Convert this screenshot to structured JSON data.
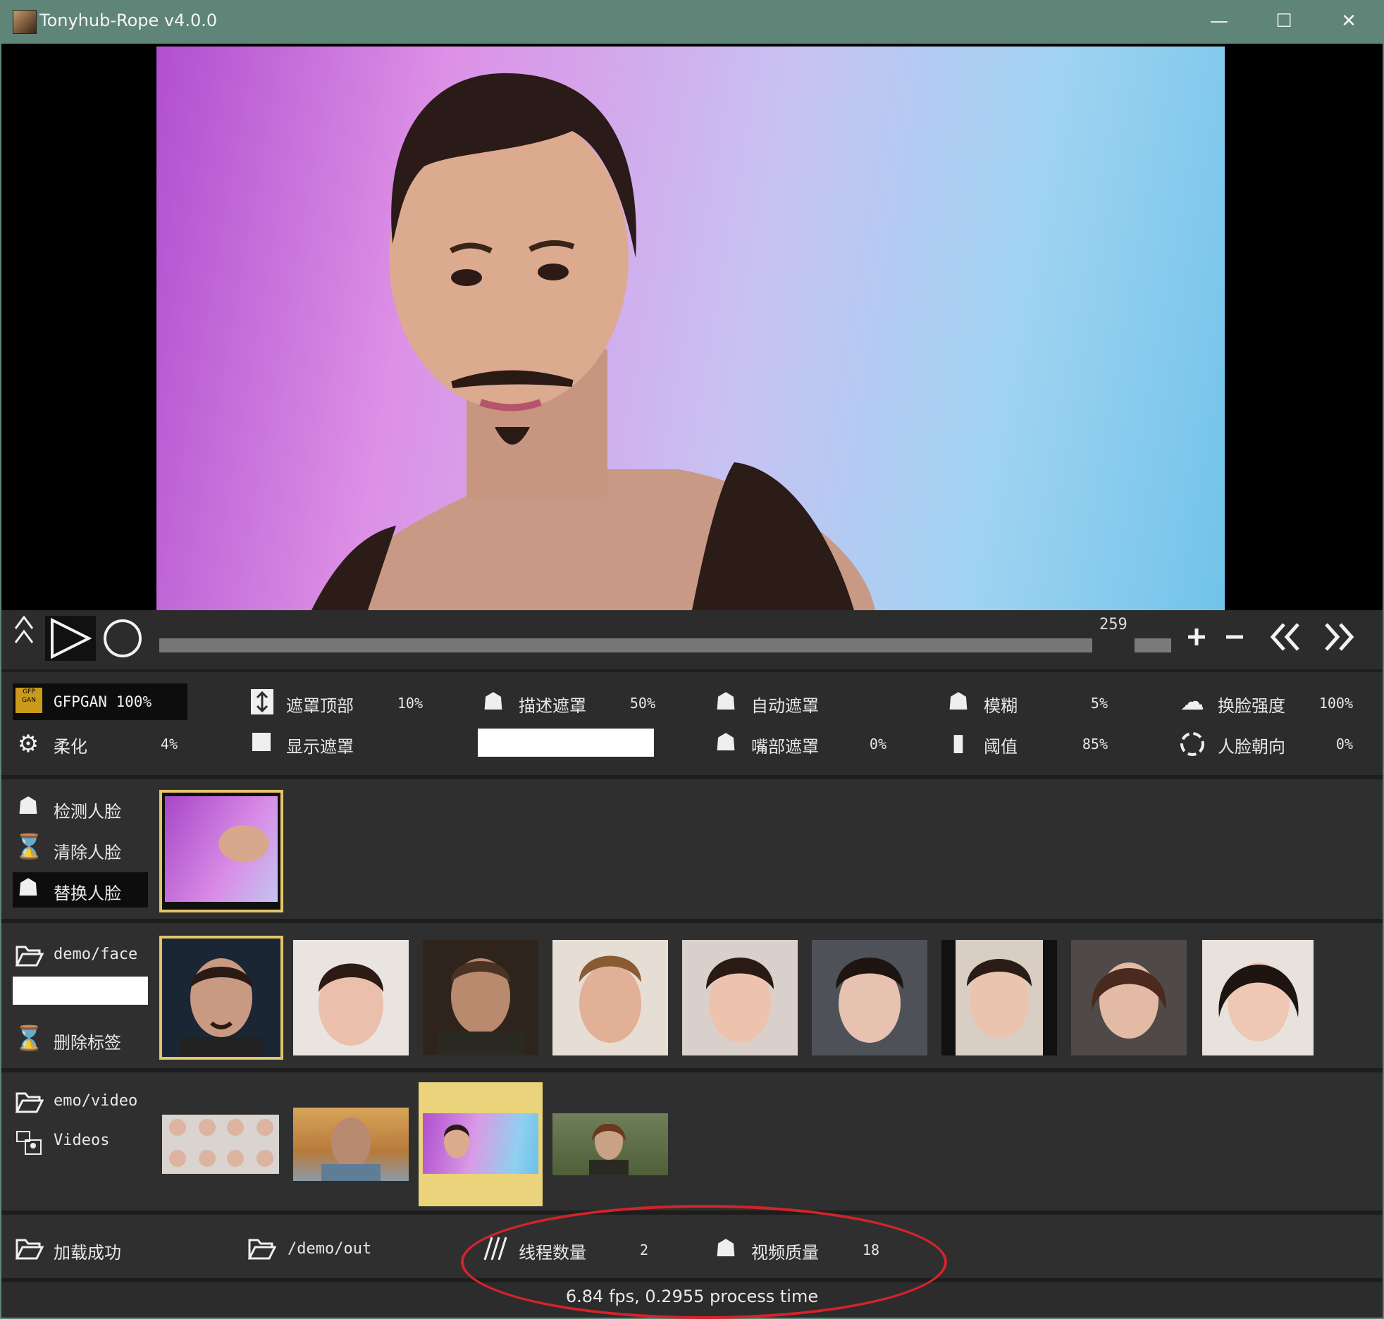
{
  "window": {
    "title": "Tonyhub-Rope v4.0.0",
    "minimize_glyph": "—",
    "maximize_glyph": "☐",
    "close_glyph": "✕"
  },
  "toolbar": {
    "frame_number": "259",
    "seek_progress": 0.0,
    "icons": [
      "chevrons-up-icon",
      "play-icon",
      "record-icon",
      "plus-icon",
      "minus-icon",
      "rewind-icon",
      "fast-forward-icon"
    ]
  },
  "params": {
    "gfpgan": {
      "label": "GFPGAN",
      "value": "100%"
    },
    "soften": {
      "label": "柔化",
      "value": "4%"
    },
    "mask_top": {
      "label": "遮罩顶部",
      "value": "10%"
    },
    "show_mask": {
      "label": "显示遮罩",
      "checked": false
    },
    "desc_mask": {
      "label": "描述遮罩",
      "value": "50%",
      "text": ""
    },
    "auto_mask": {
      "label": "自动遮罩"
    },
    "mouth_mask": {
      "label": "嘴部遮罩",
      "value": "0%"
    },
    "blur": {
      "label": "模糊",
      "value": "5%"
    },
    "threshold": {
      "label": "阈值",
      "value": "85%"
    },
    "swap_strength": {
      "label": "换脸强度",
      "value": "100%"
    },
    "face_orientation": {
      "label": "人脸朝向",
      "value": "0%"
    }
  },
  "found_faces": {
    "detect_label": "检测人脸",
    "clear_label": "清除人脸",
    "swap_label": "替换人脸",
    "count": 1
  },
  "source_faces": {
    "folder": "demo/face",
    "tag_input": "",
    "delete_tag_label": "删除标签",
    "count": 9,
    "selected_index": 0
  },
  "videos": {
    "folder": "emo/video",
    "label": "Videos",
    "count": 4,
    "selected_index": 2
  },
  "bottom": {
    "load_label": "加载成功",
    "output_folder": "/demo/out",
    "threads_label": "线程数量",
    "threads_value": "2",
    "quality_label": "视频质量",
    "quality_value": "18"
  },
  "status": "6.84 fps, 0.2955 process time",
  "colors": {
    "titlebar": "#5f8478",
    "panel": "#2f2f2f",
    "selected_border": "#e4c56a",
    "annotation": "#d2242a"
  }
}
